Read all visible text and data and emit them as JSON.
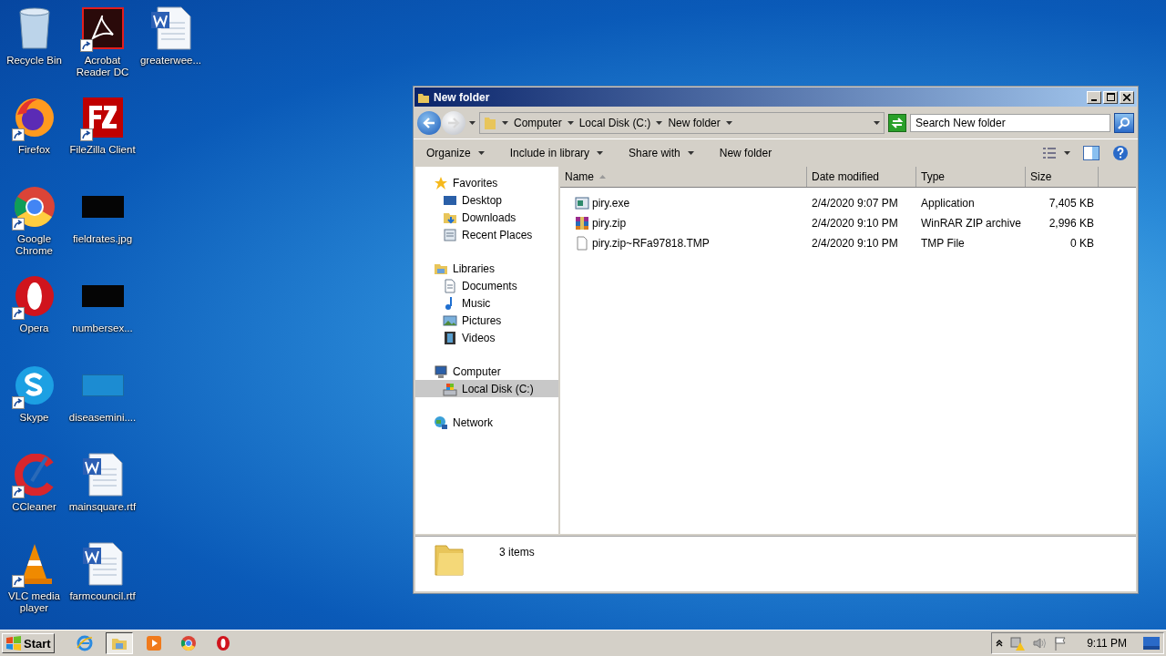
{
  "desktop": {
    "columns": [
      [
        {
          "label": "Recycle Bin",
          "kind": "recycle",
          "shortcut": false
        },
        {
          "label": "Firefox",
          "kind": "firefox",
          "shortcut": true
        },
        {
          "label": "Google Chrome",
          "kind": "chrome",
          "shortcut": true
        },
        {
          "label": "Opera",
          "kind": "opera",
          "shortcut": true
        },
        {
          "label": "Skype",
          "kind": "skype",
          "shortcut": true
        },
        {
          "label": "CCleaner",
          "kind": "ccleaner",
          "shortcut": true
        },
        {
          "label": "VLC media player",
          "kind": "vlc",
          "shortcut": true
        }
      ],
      [
        {
          "label": "Acrobat Reader DC",
          "kind": "acrobat",
          "shortcut": true
        },
        {
          "label": "FileZilla Client",
          "kind": "filezilla",
          "shortcut": true
        },
        {
          "label": "fieldrates.jpg",
          "kind": "darkthumb",
          "shortcut": false
        },
        {
          "label": "numbersex...",
          "kind": "darkthumb",
          "shortcut": false
        },
        {
          "label": "diseasemini....",
          "kind": "blankthumb",
          "shortcut": false
        },
        {
          "label": "mainsquare.rtf",
          "kind": "word",
          "shortcut": false
        },
        {
          "label": "farmcouncil.rtf",
          "kind": "word",
          "shortcut": false
        }
      ],
      [
        {
          "label": "greaterwee...",
          "kind": "word",
          "shortcut": false
        }
      ]
    ]
  },
  "window": {
    "title": "New folder",
    "breadcrumb": [
      "Computer",
      "Local Disk (C:)",
      "New folder"
    ],
    "search": {
      "placeholder": "Search New folder"
    },
    "toolbar": [
      {
        "label": "Organize",
        "dropdown": true
      },
      {
        "label": "Include in library",
        "dropdown": true
      },
      {
        "label": "Share with",
        "dropdown": true
      },
      {
        "label": "New folder",
        "dropdown": false
      }
    ],
    "nav": [
      {
        "label": "Favorites",
        "kind": "star",
        "selected": false,
        "children": [
          {
            "label": "Desktop",
            "kind": "desktop",
            "selected": false
          },
          {
            "label": "Downloads",
            "kind": "downloads",
            "selected": false
          },
          {
            "label": "Recent Places",
            "kind": "recent",
            "selected": false
          }
        ]
      },
      {
        "label": "Libraries",
        "kind": "library",
        "selected": false,
        "children": [
          {
            "label": "Documents",
            "kind": "documents",
            "selected": false
          },
          {
            "label": "Music",
            "kind": "music",
            "selected": false
          },
          {
            "label": "Pictures",
            "kind": "pictures",
            "selected": false
          },
          {
            "label": "Videos",
            "kind": "videos",
            "selected": false
          }
        ]
      },
      {
        "label": "Computer",
        "kind": "computer",
        "selected": false,
        "children": [
          {
            "label": "Local Disk (C:)",
            "kind": "disk",
            "selected": true
          }
        ]
      },
      {
        "label": "Network",
        "kind": "network",
        "selected": false
      }
    ],
    "table": {
      "columns": [
        "Name",
        "Date modified",
        "Type",
        "Size"
      ],
      "rows": [
        {
          "name": "piry.exe",
          "kind": "exe",
          "date": "2/4/2020 9:07 PM",
          "type": "Application",
          "size": "7,405 KB"
        },
        {
          "name": "piry.zip",
          "kind": "zip",
          "date": "2/4/2020 9:10 PM",
          "type": "WinRAR ZIP archive",
          "size": "2,996 KB"
        },
        {
          "name": "piry.zip~RFa97818.TMP",
          "kind": "file",
          "date": "2/4/2020 9:10 PM",
          "type": "TMP File",
          "size": "0 KB"
        }
      ]
    },
    "status": "3 items"
  },
  "taskbar": {
    "start": "Start",
    "apps": [
      {
        "kind": "ie",
        "selected": false
      },
      {
        "kind": "explorer",
        "selected": true
      },
      {
        "kind": "media",
        "selected": false
      },
      {
        "kind": "chrome",
        "selected": false
      },
      {
        "kind": "opera",
        "selected": false
      }
    ],
    "clock": "9:11 PM"
  }
}
